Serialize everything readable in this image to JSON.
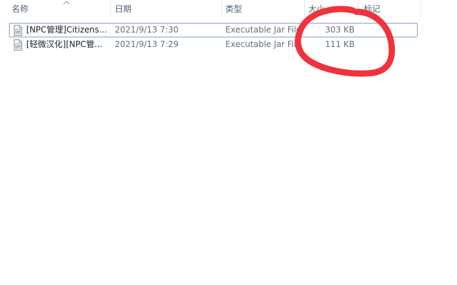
{
  "columns": {
    "name": "名称",
    "date": "日期",
    "type": "类型",
    "size": "大小",
    "tags": "标记"
  },
  "sort": {
    "column": "name",
    "direction": "ascending"
  },
  "files": [
    {
      "name": "[NPC管理]Citizens...",
      "date": "2021/9/13 7:30",
      "type": "Executable Jar File",
      "size": "303 KB",
      "focused": true
    },
    {
      "name": "[轻微汉化][NPC管...",
      "date": "2021/9/13 7:29",
      "type": "Executable Jar File",
      "size": "111 KB",
      "focused": false
    }
  ],
  "icons": {
    "file": "jar-file-icon",
    "sort": "sort-ascending-icon"
  },
  "colors": {
    "header_text": "#4c607a",
    "focus_border": "#7da2ce",
    "annotation": "#f0323c"
  }
}
